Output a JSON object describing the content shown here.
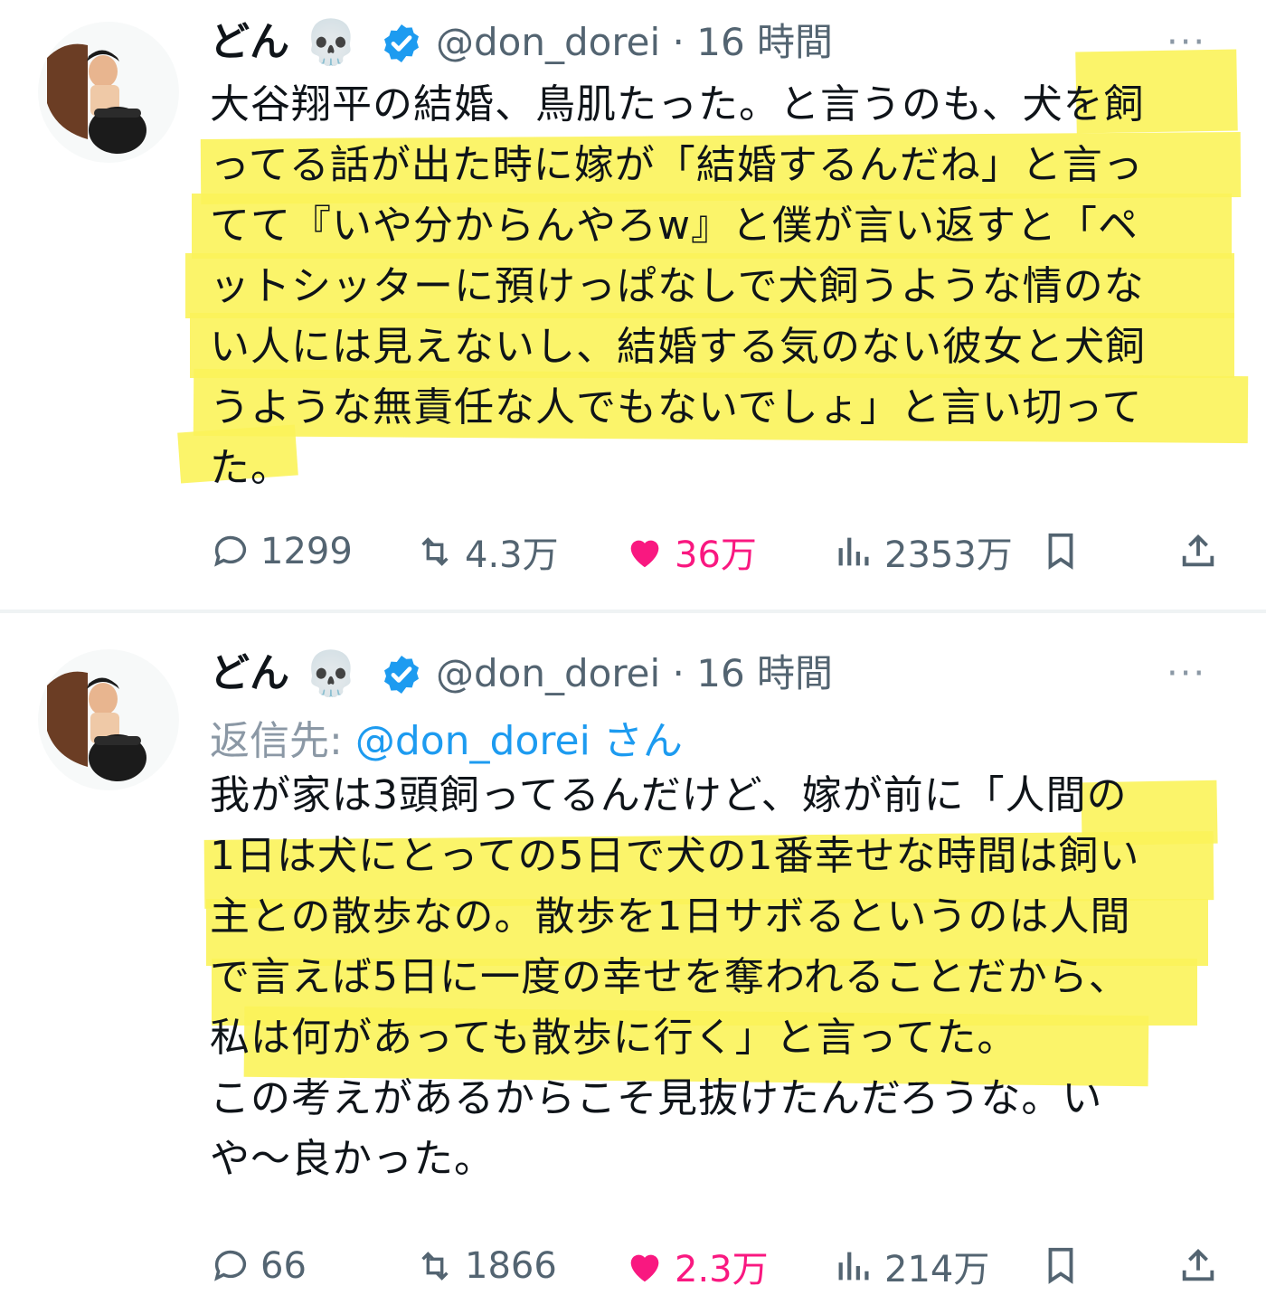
{
  "colors": {
    "text": "#0f1419",
    "muted": "#536471",
    "link": "#1d9bf0",
    "like": "#f91880",
    "highlight": "#fbf35a"
  },
  "tweets": [
    {
      "name": "どん",
      "emoji": "💀",
      "handle_time": "@don_dorei · 16 時間",
      "more": "···",
      "lines": [
        "大谷翔平の結婚、鳥肌たった。と言うのも、犬を飼",
        "ってる話が出た時に嫁が「結婚するんだね」と言っ",
        "てて『いや分からんやろw』と僕が言い返すと「ペ",
        "ットシッターに預けっぱなしで犬飼うような情のな",
        "い人には見えないし、結婚する気のない彼女と犬飼",
        "うような無責任な人でもないでしょ」と言い切って",
        "た。"
      ],
      "stats": {
        "replies": "1299",
        "retweets": "4.3万",
        "likes": "36万",
        "views": "2353万"
      }
    },
    {
      "name": "どん",
      "emoji": "💀",
      "handle_time": "@don_dorei · 16 時間",
      "more": "···",
      "reply_prefix": "返信先: ",
      "reply_mention": "@don_dorei",
      "reply_suffix": " さん",
      "lines": [
        "我が家は3頭飼ってるんだけど、嫁が前に「人間の",
        "1日は犬にとっての5日で犬の1番幸せな時間は飼い",
        "主との散歩なの。散歩を1日サボるというのは人間",
        "で言えば5日に一度の幸せを奪われることだから、",
        "私は何があっても散歩に行く」と言ってた。",
        "この考えがあるからこそ見抜けたんだろうな。い",
        "や〜良かった。"
      ],
      "stats": {
        "replies": "66",
        "retweets": "1866",
        "likes": "2.3万",
        "views": "214万"
      }
    }
  ]
}
